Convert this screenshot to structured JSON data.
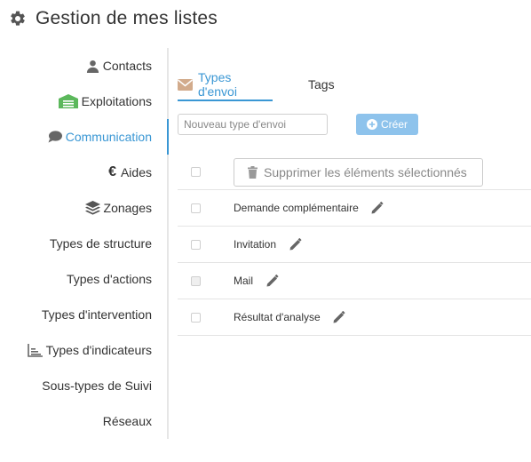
{
  "header": {
    "title": "Gestion de mes listes",
    "icon": "gear-icon"
  },
  "sidebar": {
    "items": [
      {
        "label": "Contacts",
        "icon": "user-icon"
      },
      {
        "label": "Exploitations",
        "icon": "barn-icon",
        "icon_color": "#5cb85c"
      },
      {
        "label": "Communication",
        "icon": "chat-bubble-icon",
        "active": true
      },
      {
        "label": "Aides",
        "icon": "euro-icon"
      },
      {
        "label": "Zonages",
        "icon": "layers-icon"
      },
      {
        "label": "Types de structure"
      },
      {
        "label": "Types d'actions"
      },
      {
        "label": "Types d'intervention"
      },
      {
        "label": "Types d'indicateurs",
        "icon": "chart-axes-icon"
      },
      {
        "label": "Sous-types de Suivi"
      },
      {
        "label": "Réseaux"
      }
    ]
  },
  "tabs": [
    {
      "label": "Types d'envoi",
      "icon": "envelope-icon",
      "active": true
    },
    {
      "label": "Tags"
    }
  ],
  "form": {
    "placeholder": "Nouveau type d'envoi",
    "value": "",
    "create_label": "Créer"
  },
  "table": {
    "delete_label": "Supprimer les éléments sélectionnés",
    "rows": [
      {
        "label": "Demande complémentaire",
        "checkbox_disabled": false
      },
      {
        "label": "Invitation",
        "checkbox_disabled": false
      },
      {
        "label": "Mail",
        "checkbox_disabled": true
      },
      {
        "label": "Résultat d'analyse",
        "checkbox_disabled": false
      }
    ]
  },
  "colors": {
    "accent": "#3a97d4",
    "create_button": "#8ec3ec",
    "envelope": "#d2ab8c",
    "text": "#333333",
    "muted": "#888888"
  }
}
